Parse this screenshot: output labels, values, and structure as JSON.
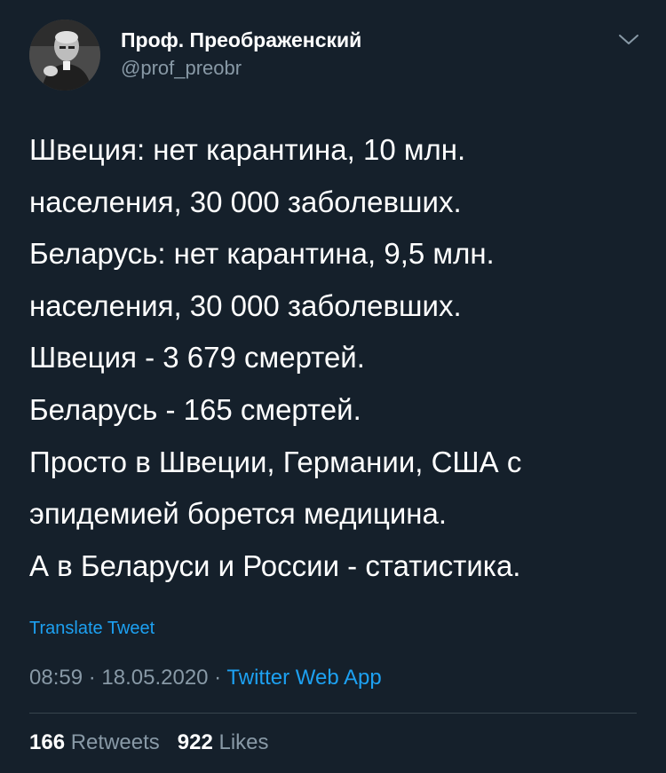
{
  "author": {
    "display_name": "Проф. Преображенский",
    "handle": "@prof_preobr",
    "avatar_icon": "avatar-photo",
    "menu_icon": "chevron-down-icon"
  },
  "tweet": {
    "lines": [
      "Швеция: нет карантина, 10 млн.",
      "населения, 30 000 заболевших.",
      "Беларусь: нет карантина, 9,5 млн.",
      "населения, 30 000 заболевших.",
      "Швеция - 3 679 смертей.",
      "Беларусь - 165 смертей.",
      "Просто в Швеции, Германии, США с",
      "эпидемией борется медицина.",
      "А в Беларуси и России - статистика."
    ],
    "translate_label": "Translate Tweet",
    "time": "08:59",
    "separator": " · ",
    "date": "18.05.2020",
    "source": "Twitter Web App"
  },
  "stats": {
    "retweets_count": "166",
    "retweets_label": "Retweets",
    "likes_count": "922",
    "likes_label": "Likes"
  },
  "colors": {
    "background": "#15202b",
    "text": "#ffffff",
    "secondary": "#8899a6",
    "accent": "#1da1f2",
    "divider": "#38444d"
  }
}
